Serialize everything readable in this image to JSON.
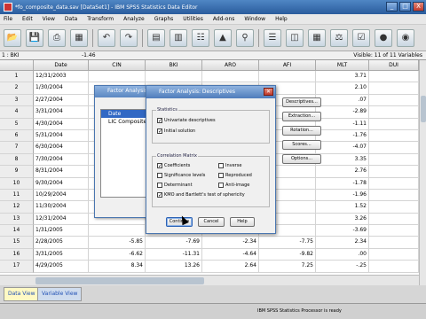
{
  "window": {
    "title": "*fo_composite_data.sav [DataSet1] - IBM SPSS Statistics Data Editor",
    "controls": {
      "minimize": "_",
      "maximize": "□",
      "close": "X"
    }
  },
  "menu": [
    "File",
    "Edit",
    "View",
    "Data",
    "Transform",
    "Analyze",
    "Graphs",
    "Utilities",
    "Add-ons",
    "Window",
    "Help"
  ],
  "refbar": {
    "cell": "1 : BKI",
    "value": "-1.46",
    "visible": "Visible: 11 of 11 Variables"
  },
  "columns": [
    "",
    "Date",
    "CIN",
    "BKI",
    "ARO",
    "AFI",
    "MLT",
    "DUI"
  ],
  "rows": [
    [
      "1",
      "12/31/2003",
      "",
      "",
      "",
      "",
      "3.71",
      ""
    ],
    [
      "2",
      "1/30/2004",
      "",
      "",
      "",
      "",
      "2.10",
      ""
    ],
    [
      "3",
      "2/27/2004",
      "",
      "",
      "",
      "",
      ".07",
      ""
    ],
    [
      "4",
      "3/31/2004",
      "",
      "",
      "",
      "",
      "-2.89",
      ""
    ],
    [
      "5",
      "4/30/2004",
      "",
      "",
      "",
      "",
      "-1.11",
      ""
    ],
    [
      "6",
      "5/31/2004",
      "",
      "",
      "",
      "",
      "-1.76",
      ""
    ],
    [
      "7",
      "6/30/2004",
      "",
      "",
      "",
      "",
      "-4.07",
      ""
    ],
    [
      "8",
      "7/30/2004",
      "",
      "",
      "",
      "",
      "3.35",
      ""
    ],
    [
      "9",
      "8/31/2004",
      "",
      "",
      "",
      "",
      "2.76",
      ""
    ],
    [
      "10",
      "9/30/2004",
      "",
      "",
      "",
      "",
      "-1.78",
      ""
    ],
    [
      "11",
      "10/29/2004",
      "",
      "",
      "",
      "",
      "-1.96",
      ""
    ],
    [
      "12",
      "11/30/2004",
      "",
      "",
      "",
      "",
      "1.52",
      ""
    ],
    [
      "13",
      "12/31/2004",
      "",
      "",
      "",
      "",
      "3.26",
      ""
    ],
    [
      "14",
      "1/31/2005",
      "",
      "",
      "",
      "",
      "-3.69",
      ""
    ],
    [
      "15",
      "2/28/2005",
      "-5.85",
      "-7.69",
      "-2.34",
      "-7.75",
      "2.34",
      ""
    ],
    [
      "16",
      "3/31/2005",
      "-6.62",
      "-11.31",
      "-4.64",
      "-9.82",
      ".00",
      ""
    ],
    [
      "17",
      "4/29/2005",
      "8.34",
      "13.26",
      "2.64",
      "7.25",
      "-.25",
      ""
    ]
  ],
  "bg_dialog": {
    "title": "Factor Analysis",
    "list": [
      "Date",
      "LIC Composite"
    ]
  },
  "dialog": {
    "title": "Factor Analysis: Descriptives",
    "statistics_label": "Statistics",
    "statistics": [
      {
        "label": "Univariate descriptives",
        "checked": true
      },
      {
        "label": "Initial solution",
        "checked": true
      }
    ],
    "matrix_label": "Correlation Matrix",
    "matrix_left": [
      {
        "label": "Coefficients",
        "checked": true
      },
      {
        "label": "Significance levels",
        "checked": false
      },
      {
        "label": "Determinant",
        "checked": false
      },
      {
        "label": "KMO and Bartlett's test of sphericity",
        "checked": true
      }
    ],
    "matrix_right": [
      {
        "label": "Inverse",
        "checked": false
      },
      {
        "label": "Reproduced",
        "checked": false
      },
      {
        "label": "Anti-image",
        "checked": false
      }
    ],
    "buttons": {
      "continue": "Continue",
      "cancel": "Cancel",
      "help": "Help"
    }
  },
  "side_buttons": [
    "Descriptives...",
    "Extraction...",
    "Rotation...",
    "Scores...",
    "Options..."
  ],
  "tabs": {
    "data_view": "Data View",
    "variable_view": "Variable View"
  },
  "status": "IBM SPSS Statistics Processor is ready",
  "colors": {
    "titlebar": "#2a5c9d",
    "selection": "#3168c4",
    "tab_active": "#fff9c4"
  },
  "toolbar_icons": [
    "open-icon",
    "save-icon",
    "print-icon",
    "dialog-recall-icon",
    "undo-icon",
    "redo-icon",
    "goto-case-icon",
    "goto-variable-icon",
    "variables-icon",
    "run-descriptives-icon",
    "find-icon",
    "insert-cases-icon",
    "insert-variable-icon",
    "split-file-icon",
    "weight-cases-icon",
    "select-cases-icon",
    "value-labels-icon",
    "use-sets-icon"
  ]
}
